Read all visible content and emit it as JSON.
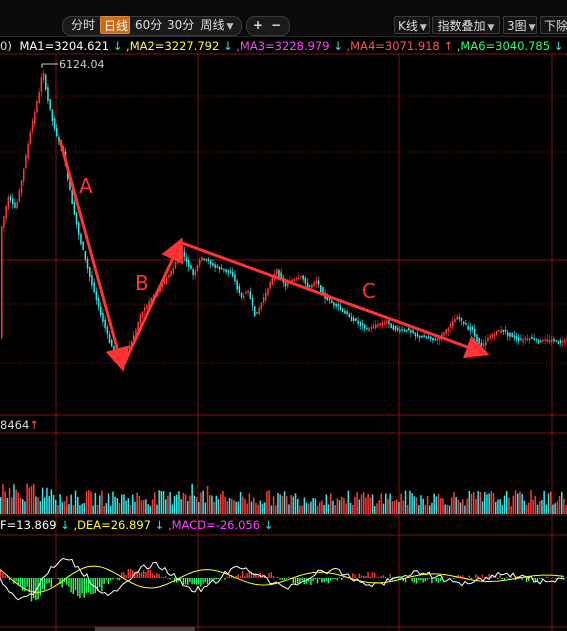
{
  "toolbar": {
    "tabs": [
      {
        "label": "分时"
      },
      {
        "label": "日线"
      },
      {
        "label": "60分"
      },
      {
        "label": "30分"
      },
      {
        "label": "周线"
      }
    ],
    "zoom_in": "+",
    "zoom_out": "−",
    "k_line": "K线",
    "index_overlay": "指数叠加",
    "layout": "3图",
    "right_cut": "下除"
  },
  "ma_line": {
    "prefix": "0)",
    "ma1": "MA1=3204.621",
    "ma2": ",MA2=3227.792",
    "ma3": ",MA3=3228.979",
    "ma4": ",MA4=3071.918",
    "ma6": ",MA6=3040.785",
    "arrow_down": "↓",
    "arrow_up": "↑"
  },
  "chart_data": {
    "type": "candlestick",
    "peak_label": "6124.04",
    "wave_labels": [
      "A",
      "B",
      "C"
    ],
    "volume_label": "8464",
    "macd_line": {
      "dif": "F=13.869",
      "dea": ",DEA=26.897",
      "macd": ",MACD=-26.056"
    }
  },
  "colors": {
    "up": "#ff3a3a",
    "down": "#3de6e6",
    "grid": "#7a1212",
    "ma1": "#ffffff",
    "ma2": "#ffff33",
    "ma3": "#ff44ff",
    "ma4": "#ff4d4d",
    "ma6": "#33ff66",
    "annotation": "#ff3333"
  }
}
